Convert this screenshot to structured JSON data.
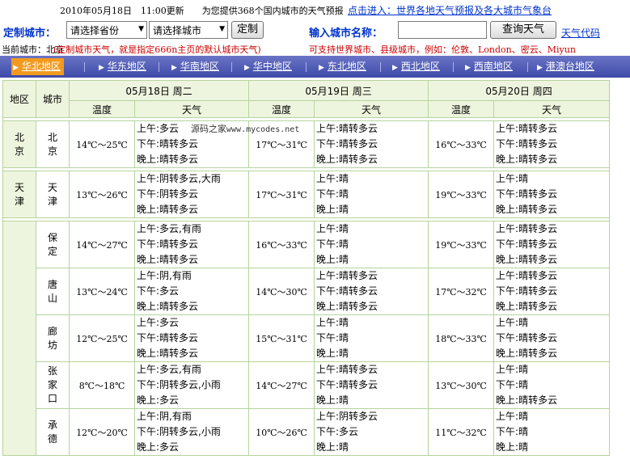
{
  "header": {
    "update_stamp": "2010年05月18日　11:00更新　　为您提供368个国内城市的天气预报",
    "world_link": "点击进入：世界各地天气预报及各大城市气象台"
  },
  "controls": {
    "custom_city_label": "定制城市：",
    "province_select": "请选择省份",
    "city_select": "请选择城市",
    "custom_button": "定制",
    "city_name_label": "输入城市名称：",
    "search_input_value": "",
    "search_button": "查询天气",
    "weather_code_link": "天气代码"
  },
  "current": {
    "label": "当前城市：北京",
    "note": "(定制城市天气，就是指定666n主页的默认城市天气)",
    "support": "可支持世界城市、县级城市，例如：伦敦、London、密云、Miyun"
  },
  "tabs": [
    "华北地区",
    "华东地区",
    "华南地区",
    "华中地区",
    "东北地区",
    "西北地区",
    "西南地区",
    "港澳台地区"
  ],
  "table": {
    "region_header": "地区",
    "city_header": "城市",
    "dates": [
      "05月18日 周二",
      "05月19日 周三",
      "05月20日 周四"
    ],
    "temp_header": "温度",
    "weather_header": "天气"
  },
  "watermark": {
    "name": "源码之家",
    "domain": "www.mycodes.net"
  },
  "rows": [
    {
      "region": "北京",
      "city": "北京",
      "days": [
        {
          "temp": "14℃～25℃",
          "am": "上午:多云",
          "pm": "下午:晴转多云",
          "night": "晚上:晴转多云"
        },
        {
          "temp": "17℃～31℃",
          "am": "上午:晴转多云",
          "pm": "下午:晴转多云",
          "night": "晚上:晴转多云"
        },
        {
          "temp": "16℃～33℃",
          "am": "上午:晴转多云",
          "pm": "下午:晴转多云",
          "night": "晚上:晴转多云"
        }
      ]
    },
    {
      "region": "天津",
      "city": "天津",
      "days": [
        {
          "temp": "13℃～26℃",
          "am": "上午:阴转多云,大雨",
          "pm": "下午:阴转多云",
          "night": "晚上:晴转多云"
        },
        {
          "temp": "17℃～31℃",
          "am": "上午:晴",
          "pm": "下午:晴",
          "night": "晚上:晴"
        },
        {
          "temp": "19℃～33℃",
          "am": "上午:晴",
          "pm": "下午:晴转多云",
          "night": "晚上:晴转多云"
        }
      ]
    },
    {
      "region": "",
      "city": "保定",
      "days": [
        {
          "temp": "14℃～27℃",
          "am": "上午:多云,有雨",
          "pm": "下午:晴转多云",
          "night": "晚上:晴转多云"
        },
        {
          "temp": "16℃～33℃",
          "am": "上午:晴",
          "pm": "下午:晴",
          "night": "晚上:晴"
        },
        {
          "temp": "19℃～33℃",
          "am": "上午:晴转多云",
          "pm": "下午:晴转多云",
          "night": "晚上:晴转多云"
        }
      ]
    },
    {
      "region": "",
      "city": "唐山",
      "days": [
        {
          "temp": "13℃～24℃",
          "am": "上午:阴,有雨",
          "pm": "下午:多云",
          "night": "晚上:晴转多云"
        },
        {
          "temp": "14℃～30℃",
          "am": "上午:晴转多云",
          "pm": "下午:晴转多云",
          "night": "晚上:晴转多云"
        },
        {
          "temp": "17℃～32℃",
          "am": "上午:晴转多云",
          "pm": "下午:晴转多云",
          "night": "晚上:晴转多云"
        }
      ]
    },
    {
      "region": "",
      "city": "廊坊",
      "days": [
        {
          "temp": "12℃～25℃",
          "am": "上午:多云",
          "pm": "下午:晴转多云",
          "night": "晚上:晴转多云"
        },
        {
          "temp": "15℃～31℃",
          "am": "上午:晴",
          "pm": "下午:晴",
          "night": "晚上:晴"
        },
        {
          "temp": "18℃～33℃",
          "am": "上午:晴",
          "pm": "下午:晴转多云",
          "night": "晚上:晴转多云"
        }
      ]
    },
    {
      "region": "",
      "city": "张家口",
      "days": [
        {
          "temp": "8℃～18℃",
          "am": "上午:多云,有雨",
          "pm": "下午:阴转多云,小雨",
          "night": "晚上:多云"
        },
        {
          "temp": "14℃～27℃",
          "am": "上午:晴转多云",
          "pm": "下午:晴转多云",
          "night": "晚上:晴"
        },
        {
          "temp": "13℃～30℃",
          "am": "上午:晴",
          "pm": "下午:晴",
          "night": "晚上:晴转多云"
        }
      ]
    },
    {
      "region": "",
      "city": "承德",
      "days": [
        {
          "temp": "12℃～20℃",
          "am": "上午:阴,有雨",
          "pm": "下午:阴转多云,小雨",
          "night": "晚上:多云"
        },
        {
          "temp": "10℃～26℃",
          "am": "上午:阴转多云",
          "pm": "下午:多云",
          "night": "晚上:晴"
        },
        {
          "temp": "11℃～32℃",
          "am": "上午:晴",
          "pm": "下午:晴",
          "night": "晚上:晴"
        }
      ]
    }
  ],
  "colors": {
    "link_blue": "#0033cc",
    "note_red": "#cc0000",
    "tab_bar": "#4a55b0",
    "tab_active": "#f29a1f",
    "table_header_bg": "#eef5de",
    "table_border": "#b6d39e"
  }
}
